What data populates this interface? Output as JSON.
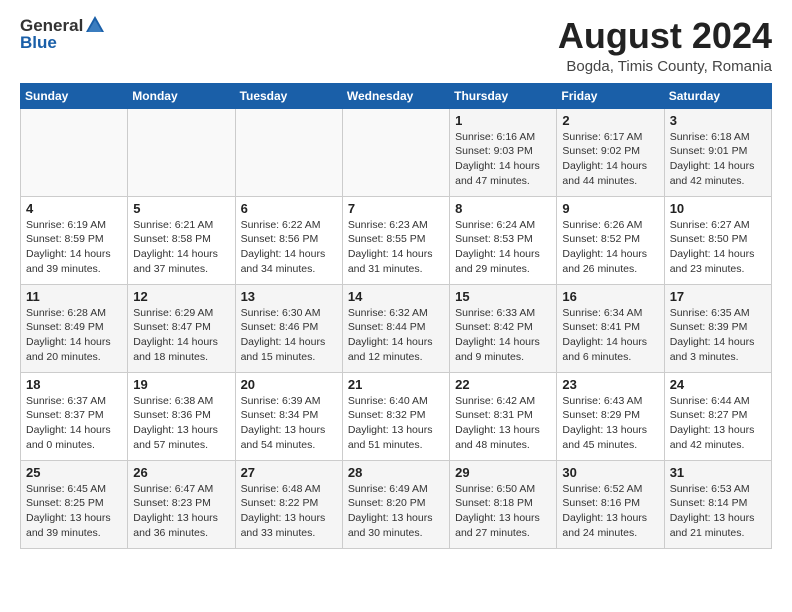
{
  "header": {
    "logo_general": "General",
    "logo_blue": "Blue",
    "month": "August 2024",
    "location": "Bogda, Timis County, Romania"
  },
  "days_of_week": [
    "Sunday",
    "Monday",
    "Tuesday",
    "Wednesday",
    "Thursday",
    "Friday",
    "Saturday"
  ],
  "weeks": [
    [
      {
        "day": "",
        "info": ""
      },
      {
        "day": "",
        "info": ""
      },
      {
        "day": "",
        "info": ""
      },
      {
        "day": "",
        "info": ""
      },
      {
        "day": "1",
        "info": "Sunrise: 6:16 AM\nSunset: 9:03 PM\nDaylight: 14 hours\nand 47 minutes."
      },
      {
        "day": "2",
        "info": "Sunrise: 6:17 AM\nSunset: 9:02 PM\nDaylight: 14 hours\nand 44 minutes."
      },
      {
        "day": "3",
        "info": "Sunrise: 6:18 AM\nSunset: 9:01 PM\nDaylight: 14 hours\nand 42 minutes."
      }
    ],
    [
      {
        "day": "4",
        "info": "Sunrise: 6:19 AM\nSunset: 8:59 PM\nDaylight: 14 hours\nand 39 minutes."
      },
      {
        "day": "5",
        "info": "Sunrise: 6:21 AM\nSunset: 8:58 PM\nDaylight: 14 hours\nand 37 minutes."
      },
      {
        "day": "6",
        "info": "Sunrise: 6:22 AM\nSunset: 8:56 PM\nDaylight: 14 hours\nand 34 minutes."
      },
      {
        "day": "7",
        "info": "Sunrise: 6:23 AM\nSunset: 8:55 PM\nDaylight: 14 hours\nand 31 minutes."
      },
      {
        "day": "8",
        "info": "Sunrise: 6:24 AM\nSunset: 8:53 PM\nDaylight: 14 hours\nand 29 minutes."
      },
      {
        "day": "9",
        "info": "Sunrise: 6:26 AM\nSunset: 8:52 PM\nDaylight: 14 hours\nand 26 minutes."
      },
      {
        "day": "10",
        "info": "Sunrise: 6:27 AM\nSunset: 8:50 PM\nDaylight: 14 hours\nand 23 minutes."
      }
    ],
    [
      {
        "day": "11",
        "info": "Sunrise: 6:28 AM\nSunset: 8:49 PM\nDaylight: 14 hours\nand 20 minutes."
      },
      {
        "day": "12",
        "info": "Sunrise: 6:29 AM\nSunset: 8:47 PM\nDaylight: 14 hours\nand 18 minutes."
      },
      {
        "day": "13",
        "info": "Sunrise: 6:30 AM\nSunset: 8:46 PM\nDaylight: 14 hours\nand 15 minutes."
      },
      {
        "day": "14",
        "info": "Sunrise: 6:32 AM\nSunset: 8:44 PM\nDaylight: 14 hours\nand 12 minutes."
      },
      {
        "day": "15",
        "info": "Sunrise: 6:33 AM\nSunset: 8:42 PM\nDaylight: 14 hours\nand 9 minutes."
      },
      {
        "day": "16",
        "info": "Sunrise: 6:34 AM\nSunset: 8:41 PM\nDaylight: 14 hours\nand 6 minutes."
      },
      {
        "day": "17",
        "info": "Sunrise: 6:35 AM\nSunset: 8:39 PM\nDaylight: 14 hours\nand 3 minutes."
      }
    ],
    [
      {
        "day": "18",
        "info": "Sunrise: 6:37 AM\nSunset: 8:37 PM\nDaylight: 14 hours\nand 0 minutes."
      },
      {
        "day": "19",
        "info": "Sunrise: 6:38 AM\nSunset: 8:36 PM\nDaylight: 13 hours\nand 57 minutes."
      },
      {
        "day": "20",
        "info": "Sunrise: 6:39 AM\nSunset: 8:34 PM\nDaylight: 13 hours\nand 54 minutes."
      },
      {
        "day": "21",
        "info": "Sunrise: 6:40 AM\nSunset: 8:32 PM\nDaylight: 13 hours\nand 51 minutes."
      },
      {
        "day": "22",
        "info": "Sunrise: 6:42 AM\nSunset: 8:31 PM\nDaylight: 13 hours\nand 48 minutes."
      },
      {
        "day": "23",
        "info": "Sunrise: 6:43 AM\nSunset: 8:29 PM\nDaylight: 13 hours\nand 45 minutes."
      },
      {
        "day": "24",
        "info": "Sunrise: 6:44 AM\nSunset: 8:27 PM\nDaylight: 13 hours\nand 42 minutes."
      }
    ],
    [
      {
        "day": "25",
        "info": "Sunrise: 6:45 AM\nSunset: 8:25 PM\nDaylight: 13 hours\nand 39 minutes."
      },
      {
        "day": "26",
        "info": "Sunrise: 6:47 AM\nSunset: 8:23 PM\nDaylight: 13 hours\nand 36 minutes."
      },
      {
        "day": "27",
        "info": "Sunrise: 6:48 AM\nSunset: 8:22 PM\nDaylight: 13 hours\nand 33 minutes."
      },
      {
        "day": "28",
        "info": "Sunrise: 6:49 AM\nSunset: 8:20 PM\nDaylight: 13 hours\nand 30 minutes."
      },
      {
        "day": "29",
        "info": "Sunrise: 6:50 AM\nSunset: 8:18 PM\nDaylight: 13 hours\nand 27 minutes."
      },
      {
        "day": "30",
        "info": "Sunrise: 6:52 AM\nSunset: 8:16 PM\nDaylight: 13 hours\nand 24 minutes."
      },
      {
        "day": "31",
        "info": "Sunrise: 6:53 AM\nSunset: 8:14 PM\nDaylight: 13 hours\nand 21 minutes."
      }
    ]
  ]
}
